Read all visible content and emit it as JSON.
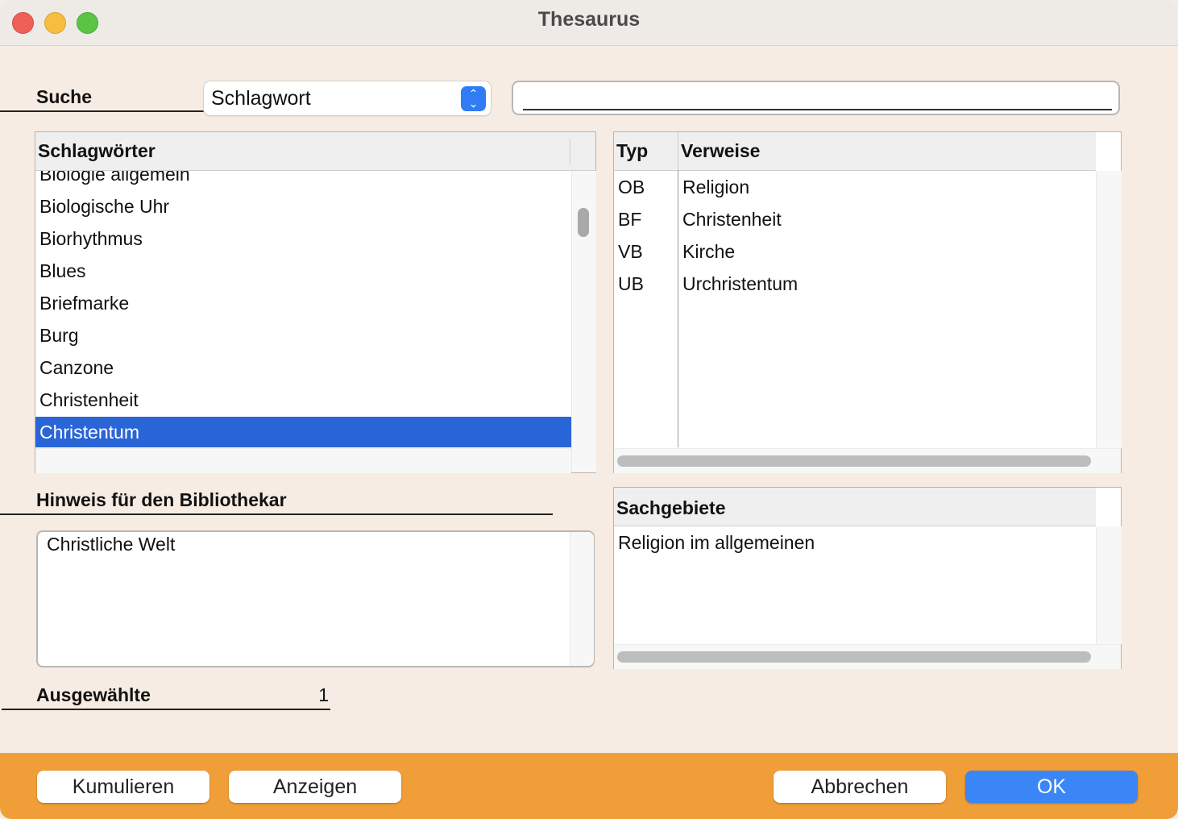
{
  "window": {
    "title": "Thesaurus"
  },
  "search": {
    "label": "Suche",
    "mode_value": "Schlagwort",
    "query": ""
  },
  "keywords": {
    "header": "Schlagwörter",
    "items": [
      "Biologie allgemein",
      "Biologische Uhr",
      "Biorhythmus",
      "Blues",
      "Briefmarke",
      "Burg",
      "Canzone",
      "Christenheit",
      "Christentum"
    ],
    "selected": "Christentum"
  },
  "references": {
    "header_type": "Typ",
    "header_refs": "Verweise",
    "rows": [
      {
        "type": "OB",
        "ref": "Religion"
      },
      {
        "type": "BF",
        "ref": "Christenheit"
      },
      {
        "type": "VB",
        "ref": "Kirche"
      },
      {
        "type": "UB",
        "ref": "Urchristentum"
      }
    ]
  },
  "note": {
    "label": "Hinweis für den Bibliothekar",
    "text": "Christliche Welt"
  },
  "subjects": {
    "header": "Sachgebiete",
    "items": [
      "Religion im allgemeinen"
    ]
  },
  "selected_count": {
    "label": "Ausgewählte",
    "value": "1"
  },
  "buttons": {
    "accumulate": "Kumulieren",
    "show": "Anzeigen",
    "cancel": "Abbrechen",
    "ok": "OK"
  },
  "colors": {
    "accent": "#2f7cf6",
    "selection": "#2a65d8",
    "footer": "#f09f38",
    "background": "#f6ece3"
  },
  "icons": {
    "select_arrows": "chevron-up-down-icon"
  }
}
